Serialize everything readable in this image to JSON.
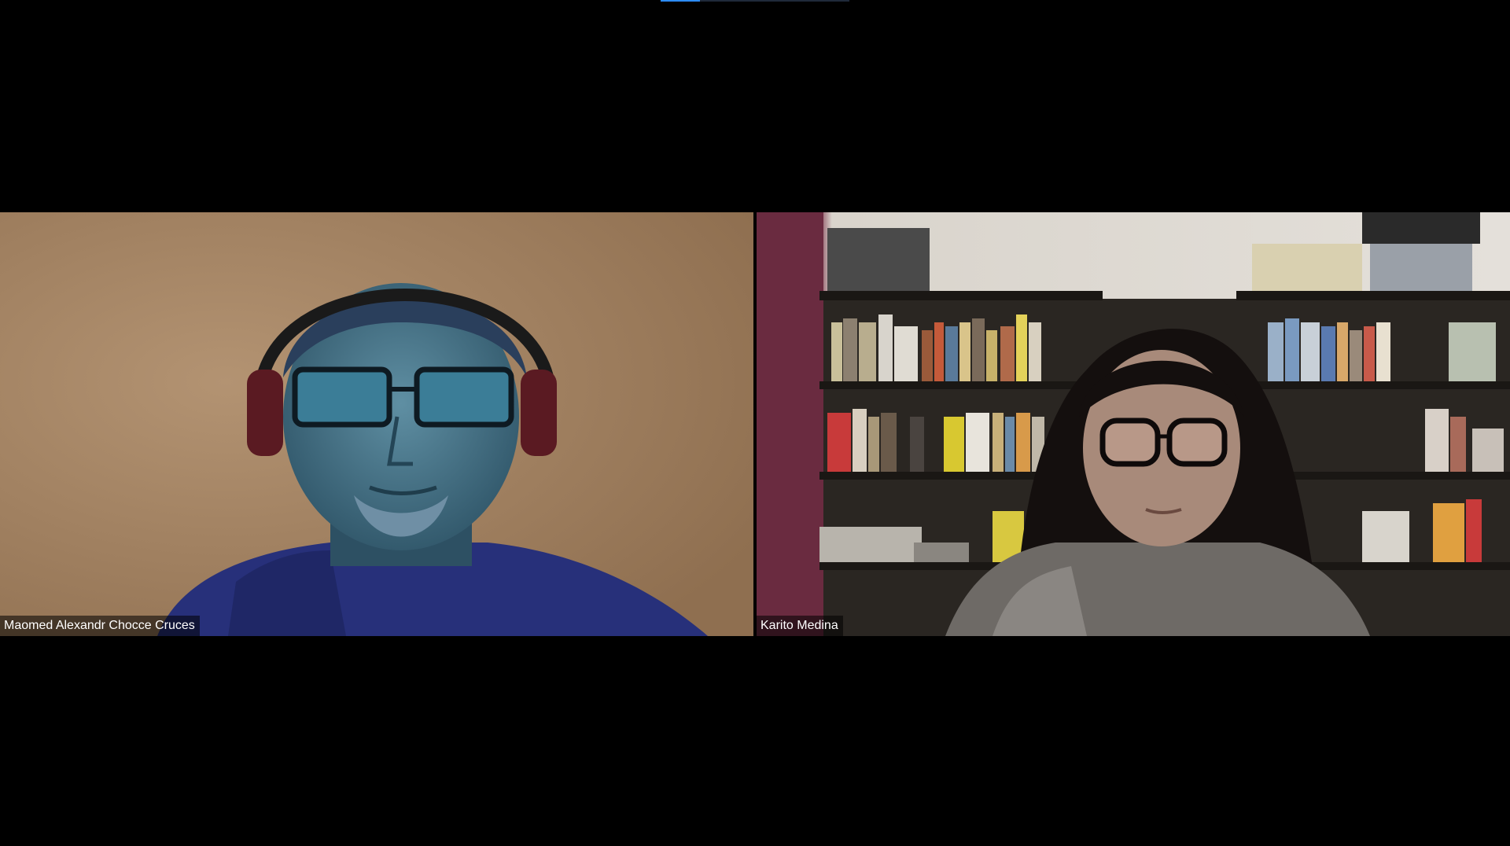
{
  "meeting": {
    "participants": [
      {
        "name": "Maomed Alexandr Chocce Cruces"
      },
      {
        "name": "Karito Medina"
      }
    ]
  },
  "colors": {
    "background": "#000000",
    "name_tag_bg": "rgba(0,0,0,0.55)",
    "name_tag_text": "#ffffff",
    "accent": "#2d8cff"
  }
}
